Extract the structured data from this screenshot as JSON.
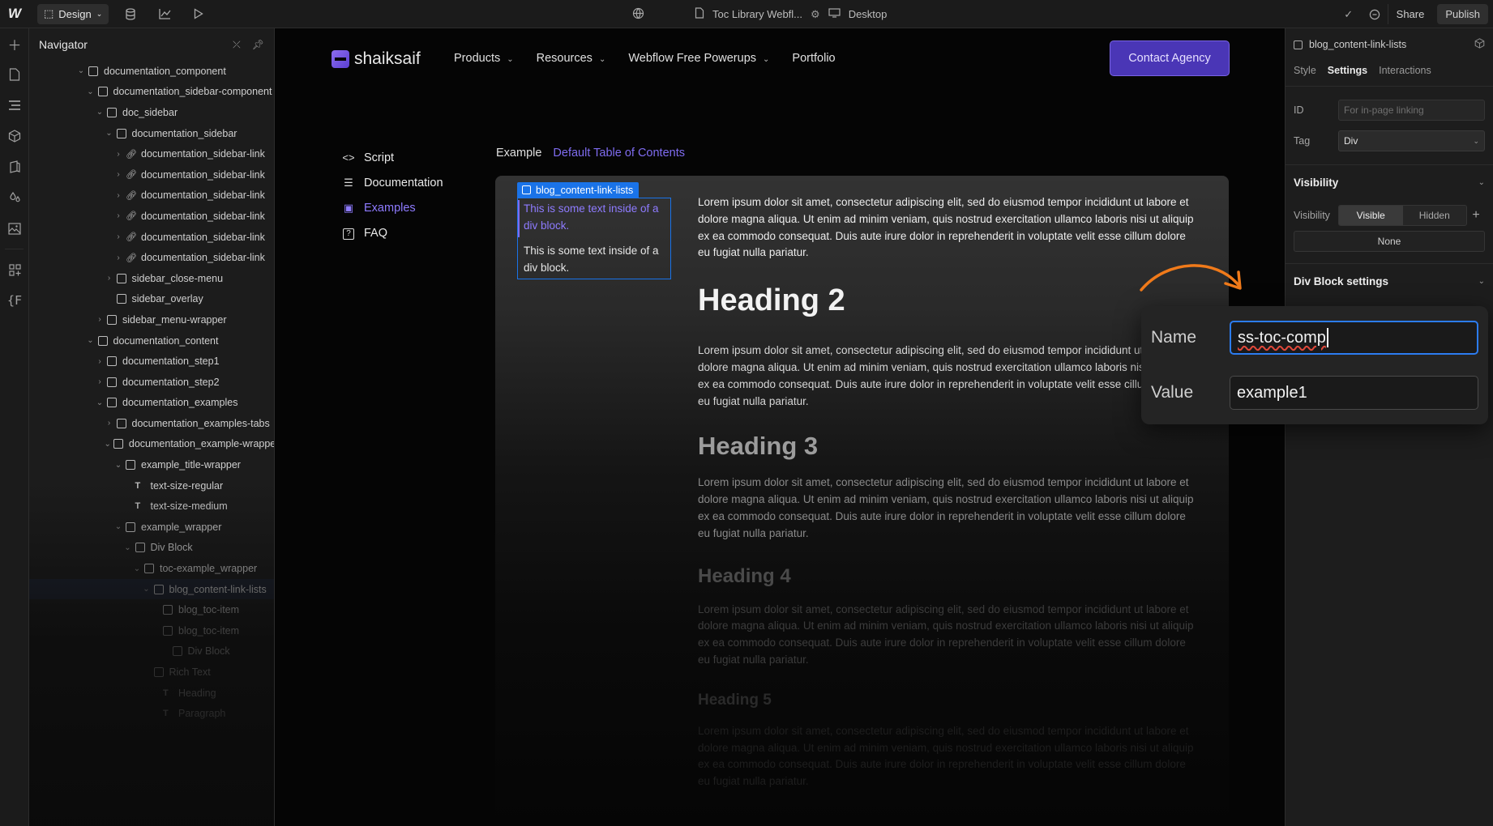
{
  "topbar": {
    "logo": "W",
    "mode": "Design",
    "page_title": "Toc Library Webfl...",
    "breakpoint": "Desktop",
    "share_label": "Share",
    "publish_label": "Publish"
  },
  "navigator": {
    "title": "Navigator",
    "rows": [
      {
        "label": "documentation_component",
        "indent": 0,
        "chev": "down",
        "icon": "box"
      },
      {
        "label": "documentation_sidebar-component",
        "indent": 1,
        "chev": "down",
        "icon": "box"
      },
      {
        "label": "doc_sidebar",
        "indent": 2,
        "chev": "down",
        "icon": "box"
      },
      {
        "label": "documentation_sidebar",
        "indent": 3,
        "chev": "down",
        "icon": "box"
      },
      {
        "label": "documentation_sidebar-link",
        "indent": 4,
        "chev": "right",
        "icon": "link"
      },
      {
        "label": "documentation_sidebar-link",
        "indent": 4,
        "chev": "right",
        "icon": "link"
      },
      {
        "label": "documentation_sidebar-link",
        "indent": 4,
        "chev": "right",
        "icon": "link"
      },
      {
        "label": "documentation_sidebar-link",
        "indent": 4,
        "chev": "right",
        "icon": "link"
      },
      {
        "label": "documentation_sidebar-link",
        "indent": 4,
        "chev": "right",
        "icon": "link"
      },
      {
        "label": "documentation_sidebar-link",
        "indent": 4,
        "chev": "right",
        "icon": "link"
      },
      {
        "label": "sidebar_close-menu",
        "indent": 3,
        "chev": "right",
        "icon": "box"
      },
      {
        "label": "sidebar_overlay",
        "indent": 3,
        "chev": "",
        "icon": "box"
      },
      {
        "label": "sidebar_menu-wrapper",
        "indent": 2,
        "chev": "right",
        "icon": "box"
      },
      {
        "label": "documentation_content",
        "indent": 1,
        "chev": "down",
        "icon": "box"
      },
      {
        "label": "documentation_step1",
        "indent": 2,
        "chev": "right",
        "icon": "box"
      },
      {
        "label": "documentation_step2",
        "indent": 2,
        "chev": "right",
        "icon": "box"
      },
      {
        "label": "documentation_examples",
        "indent": 2,
        "chev": "down",
        "icon": "box"
      },
      {
        "label": "documentation_examples-tabs",
        "indent": 3,
        "chev": "right",
        "icon": "box"
      },
      {
        "label": "documentation_example-wrapper",
        "indent": 3,
        "chev": "down",
        "icon": "box"
      },
      {
        "label": "example_title-wrapper",
        "indent": 4,
        "chev": "down",
        "icon": "box"
      },
      {
        "label": "text-size-regular",
        "indent": 5,
        "chev": "",
        "icon": "text"
      },
      {
        "label": "text-size-medium",
        "indent": 5,
        "chev": "",
        "icon": "text"
      },
      {
        "label": "example_wrapper",
        "indent": 4,
        "chev": "down",
        "icon": "box"
      },
      {
        "label": "Div Block",
        "indent": 5,
        "chev": "down",
        "icon": "box"
      },
      {
        "label": "toc-example_wrapper",
        "indent": 6,
        "chev": "down",
        "icon": "box"
      },
      {
        "label": "blog_content-link-lists",
        "indent": 7,
        "chev": "down",
        "icon": "box",
        "selected": true
      },
      {
        "label": "blog_toc-item",
        "indent": 8,
        "chev": "",
        "icon": "box"
      },
      {
        "label": "blog_toc-item",
        "indent": 8,
        "chev": "",
        "icon": "box"
      },
      {
        "label": "Div Block",
        "indent": 9,
        "chev": "",
        "icon": "box"
      },
      {
        "label": "Rich Text",
        "indent": 7,
        "chev": "",
        "icon": "box"
      },
      {
        "label": "Heading",
        "indent": 8,
        "chev": "",
        "icon": "text"
      },
      {
        "label": "Paragraph",
        "indent": 8,
        "chev": "",
        "icon": "text"
      }
    ]
  },
  "site": {
    "brand": "shaiksaif",
    "links": [
      {
        "label": "Products",
        "dropdown": true
      },
      {
        "label": "Resources",
        "dropdown": true
      },
      {
        "label": "Webflow Free Powerups",
        "dropdown": true
      },
      {
        "label": "Portfolio",
        "dropdown": false
      }
    ],
    "cta": "Contact Agency",
    "doc_menu": [
      {
        "label": "Script",
        "icon": "code",
        "active": false
      },
      {
        "label": "Documentation",
        "icon": "lines",
        "active": false
      },
      {
        "label": "Examples",
        "icon": "folder",
        "active": true
      },
      {
        "label": "FAQ",
        "icon": "question",
        "active": false
      }
    ],
    "example_label": "Example",
    "example_tab": "Default Table of Contents",
    "selected_element": "blog_content-link-lists",
    "toc_link_active": "This is some text inside of a div block.",
    "toc_link": "This is some text inside of a div block.",
    "lorem": "Lorem ipsum dolor sit amet, consectetur adipiscing elit, sed do eiusmod tempor incididunt ut labore et dolore magna aliqua. Ut enim ad minim veniam, quis nostrud exercitation ullamco laboris nisi ut aliquip ex ea commodo consequat. Duis aute irure dolor in reprehenderit in voluptate velit esse cillum dolore eu fugiat nulla pariatur.",
    "headings": [
      "Heading 2",
      "Heading 3",
      "Heading 4",
      "Heading 5"
    ]
  },
  "right_panel": {
    "element": "blog_content-link-lists",
    "tabs": [
      "Style",
      "Settings",
      "Interactions"
    ],
    "active_tab": "Settings",
    "id_label": "ID",
    "id_placeholder": "For in-page linking",
    "tag_label": "Tag",
    "tag_value": "Div",
    "visibility_section": "Visibility",
    "visibility_label": "Visibility",
    "visible_label": "Visible",
    "hidden_label": "Hidden",
    "none_label": "None",
    "div_settings": "Div Block settings"
  },
  "attribute_zoom": {
    "name_label": "Name",
    "name_value": "ss-toc-comp",
    "value_label": "Value",
    "value_value": "example1"
  },
  "colors": {
    "accent": "#7f6cf0",
    "selection": "#1a73e8",
    "cta_bg": "#4a36b6",
    "arrow": "#f07a1a"
  }
}
